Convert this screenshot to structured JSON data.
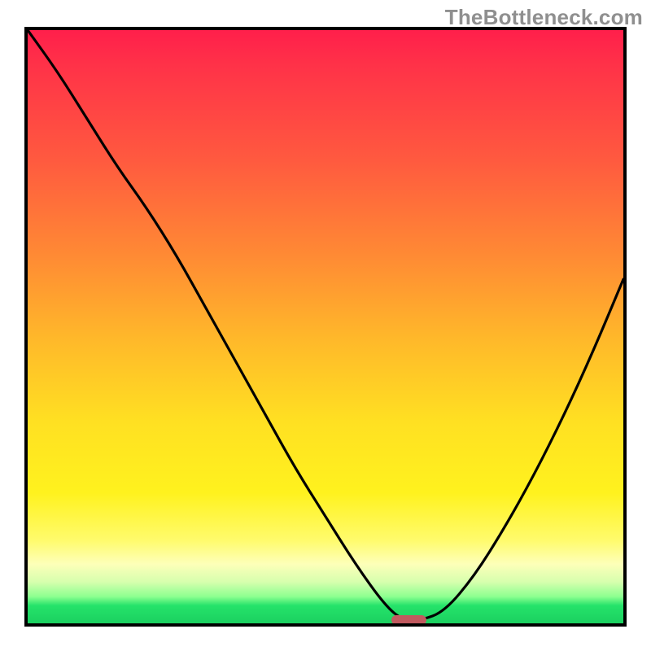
{
  "watermark": "TheBottleneck.com",
  "colors": {
    "gradient_top": "#ff1f4b",
    "gradient_mid": "#ffe022",
    "gradient_bottom": "#1bd060",
    "curve": "#000000",
    "marker": "#c15a5f",
    "frame": "#000000"
  },
  "chart_data": {
    "type": "line",
    "title": "",
    "xlabel": "",
    "ylabel": "",
    "xlim": [
      0,
      100
    ],
    "ylim": [
      0,
      100
    ],
    "grid": false,
    "legend": false,
    "note": "Values are read off the plot pixels; no tick labels present. y=0 is the bottom edge, y=100 is the top.",
    "series": [
      {
        "name": "curve",
        "x": [
          0,
          5,
          10,
          15,
          20,
          25,
          30,
          35,
          40,
          45,
          50,
          55,
          60,
          63,
          66,
          70,
          75,
          80,
          85,
          90,
          95,
          100
        ],
        "y": [
          100,
          93,
          85,
          77,
          70,
          62,
          53,
          44,
          35,
          26,
          18,
          10,
          3,
          0.5,
          0.5,
          2,
          8,
          16,
          25,
          35,
          46,
          58
        ]
      }
    ],
    "trough": {
      "x_start": 61,
      "x_end": 67,
      "y": 0.5
    },
    "background_gradient": {
      "orientation": "vertical",
      "stops": [
        {
          "pos": 0.0,
          "color": "#ff1f4b"
        },
        {
          "pos": 0.22,
          "color": "#ff5a3f"
        },
        {
          "pos": 0.52,
          "color": "#ffb82a"
        },
        {
          "pos": 0.78,
          "color": "#fff21e"
        },
        {
          "pos": 0.9,
          "color": "#fdffb9"
        },
        {
          "pos": 0.95,
          "color": "#8dff90"
        },
        {
          "pos": 1.0,
          "color": "#1bd060"
        }
      ]
    }
  }
}
